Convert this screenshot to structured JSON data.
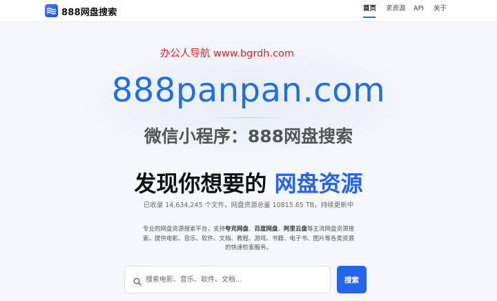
{
  "header": {
    "brand": "888网盘搜索",
    "nav": [
      {
        "label": "首页",
        "active": true
      },
      {
        "label": "求资源",
        "active": false
      },
      {
        "label": "API",
        "active": false
      },
      {
        "label": "关于",
        "active": false
      }
    ]
  },
  "watermark": {
    "line1": "办公人导航  www.bgrdh.com",
    "line2": "888panpan.com",
    "line3": "微信小程序：888网盘搜索"
  },
  "hero": {
    "title_plain": "发现你想要的 ",
    "title_accent": "网盘资源",
    "stats": "已收录 14,634,245 个文件，网盘资源总量 10815.65 TB，持续更新中"
  },
  "description": {
    "text1": "专业的网盘资源搜索平台，支持",
    "bold1": "夸克网盘",
    "sep1": "、",
    "bold2": "百度网盘",
    "sep2": "、",
    "bold3": "阿里云盘",
    "text2": "等主流网盘资源搜索。提供电影、音乐、软件、文档、教程、游戏、书籍、电子书、图片等各类资源的快速检索服务。"
  },
  "search": {
    "placeholder": "搜索电影、音乐、软件、文档...",
    "value": "",
    "button_label": "搜索"
  },
  "colors": {
    "accent": "#2563eb",
    "watermark_red": "#e02020",
    "watermark_blue": "#1f6fe0"
  }
}
